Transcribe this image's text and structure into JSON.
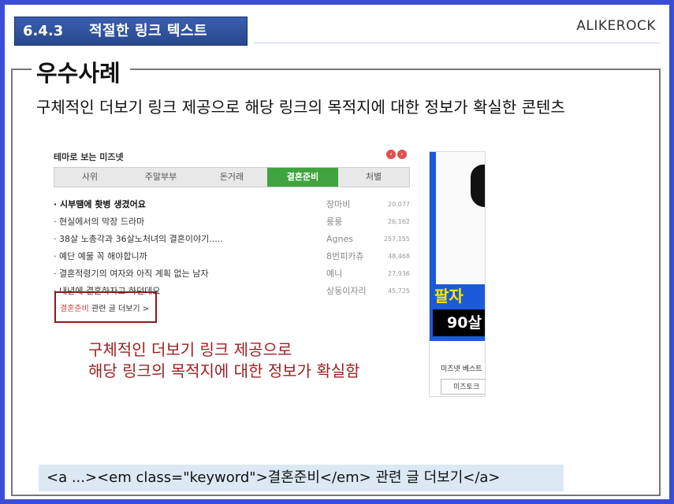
{
  "header": {
    "section_number": "6.4.3",
    "section_title": "적절한 링크 텍스트",
    "brand": "ALIKEROCK"
  },
  "main": {
    "heading": "우수사례",
    "description": "구체적인 더보기 링크 제공으로 해당 링크의 목적지에 대한 정보가 확실한 콘텐츠"
  },
  "widget": {
    "title": "테마로 보는 미즈넷",
    "tabs": [
      "사위",
      "주말부부",
      "돈거래",
      "결혼준비",
      "처별"
    ],
    "active_tab": "결혼준비",
    "rows": [
      {
        "title": "시부땜에 홧병 생겼어요",
        "author": "장마비",
        "count": "20,077"
      },
      {
        "title": "현실에서의 막장 드라마",
        "author": "룽룽",
        "count": "26,162"
      },
      {
        "title": "38살 노총각과 36살노처녀의 결혼이야기.....",
        "author": "Agnes",
        "count": "257,155"
      },
      {
        "title": "예단 예물 꼭 해야합니까",
        "author": "8번피카츄",
        "count": "48,468"
      },
      {
        "title": "결혼적령기의 여자와 아직 계획 없는 남자",
        "author": "예니",
        "count": "27,936"
      },
      {
        "title": "내년에 결혼하자고 하던데요",
        "author": "상둥이자리",
        "count": "45,725"
      }
    ],
    "more_keyword": "결혼준비",
    "more_text": " 관련 글 더보기 >"
  },
  "callout": {
    "line1": "구체적인 더보기 링크 제공으로",
    "line2": "해당 링크의 목적지에 대한 정보가 확실함"
  },
  "ad": {
    "headline": "팔자",
    "age": "90살",
    "small_label": "미즈넷 베스트",
    "button": "미즈토크"
  },
  "code_sample": "<a ...><em class=\"keyword\">결혼준비</em> 관련 글 더보기</a>",
  "colors": {
    "frame": "#3b4cd6",
    "badge": "#2f52a0",
    "active_tab": "#3fa43f",
    "callout": "#9c1f1f",
    "code_bg": "#dce8f4"
  }
}
